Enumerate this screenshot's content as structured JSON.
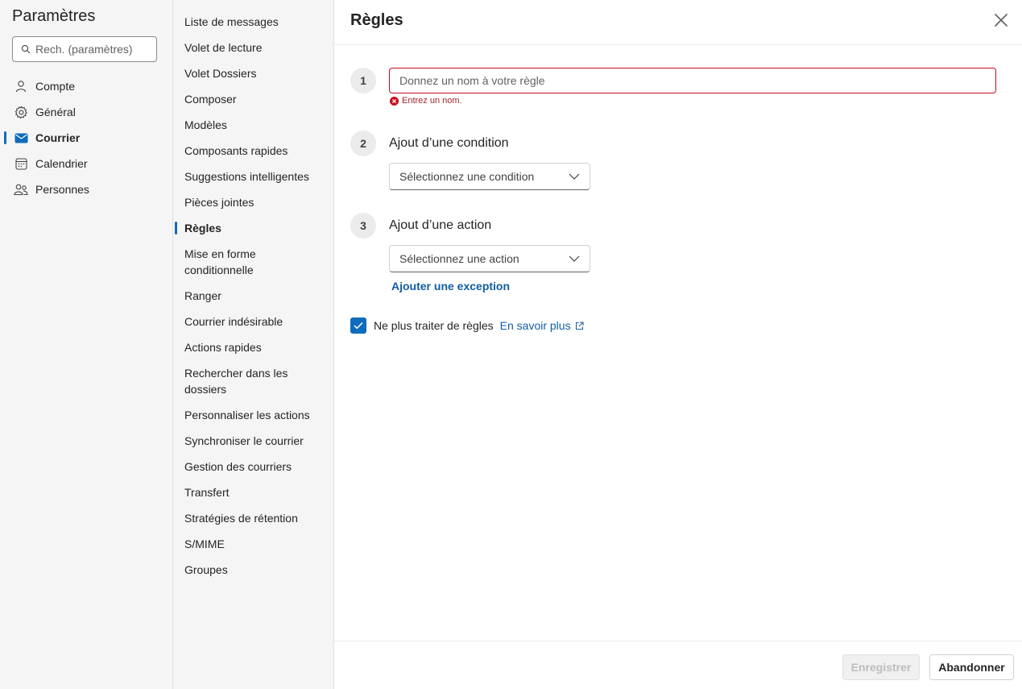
{
  "left": {
    "title": "Paramètres",
    "search_placeholder": "Rech. (paramètres)",
    "categories": [
      {
        "label": "Compte",
        "icon": "person-icon"
      },
      {
        "label": "Général",
        "icon": "gear-icon"
      },
      {
        "label": "Courrier",
        "icon": "mail-icon",
        "active": true
      },
      {
        "label": "Calendrier",
        "icon": "calendar-icon"
      },
      {
        "label": "Personnes",
        "icon": "people-icon"
      }
    ]
  },
  "middle": {
    "items": [
      "Liste de messages",
      "Volet de lecture",
      "Volet Dossiers",
      "Composer",
      "Modèles",
      "Composants rapides",
      "Suggestions intelligentes",
      "Pièces jointes",
      "Règles",
      "Mise en forme conditionnelle",
      "Ranger",
      "Courrier indésirable",
      "Actions rapides",
      "Rechercher dans les dossiers",
      "Personnaliser les actions",
      "Synchroniser le courrier",
      "Gestion des courriers",
      "Transfert",
      "Stratégies de rétention",
      "S/MIME",
      "Groupes"
    ],
    "active_item": "Règles"
  },
  "right": {
    "title": "Règles",
    "steps": {
      "one": "1",
      "two": "2",
      "three": "3"
    },
    "name_placeholder": "Donnez un nom à votre règle",
    "name_error": "Entrez un nom.",
    "condition_label": "Ajout d’une condition",
    "condition_select": "Sélectionnez une condition",
    "action_label": "Ajout d’une action",
    "action_select": "Sélectionnez une action",
    "exception_link": "Ajouter une exception",
    "stop_processing_label": "Ne plus traiter de règles",
    "stop_processing_checked": true,
    "learn_more": "En savoir plus",
    "save_button": "Enregistrer",
    "cancel_button": "Abandonner"
  },
  "colors": {
    "accent": "#0f6cbd",
    "link": "#115ea3",
    "error": "#c50f1f"
  }
}
